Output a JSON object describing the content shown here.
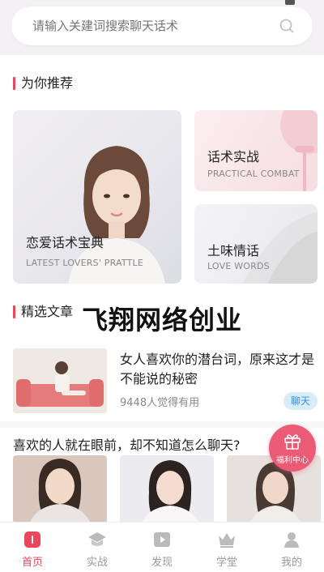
{
  "search": {
    "placeholder": "请输入关建词搜索聊天话术",
    "icon": "search-icon"
  },
  "recommend": {
    "section_title": "为你推荐",
    "cards": [
      {
        "title": "恋爱话术宝典",
        "subtitle": "LATEST LOVERS' PRATTLE"
      },
      {
        "title": "话术实战",
        "subtitle": "PRACTICAL COMBAT"
      },
      {
        "title": "土味情话",
        "subtitle": "LOVE WORDS"
      }
    ]
  },
  "watermark": {
    "text": "飞翔网络创业"
  },
  "featured": {
    "section_title": "精选文章",
    "article": {
      "title": "女人喜欢你的潜台词，原来这才是不能说的秘密",
      "meta": "9448人觉得有用",
      "tag": "聊天"
    }
  },
  "question": {
    "text": "喜欢的人就在眼前，却不知道怎么聊天?"
  },
  "floating": {
    "label": "福利中心",
    "icon": "gift-icon"
  },
  "tabbar": {
    "items": [
      {
        "label": "首页",
        "icon": "home-icon",
        "active": true
      },
      {
        "label": "实战",
        "icon": "graduation-cap-icon",
        "active": false
      },
      {
        "label": "发现",
        "icon": "play-icon",
        "active": false
      },
      {
        "label": "学堂",
        "icon": "crown-icon",
        "active": false
      },
      {
        "label": "我的",
        "icon": "user-icon",
        "active": false
      }
    ]
  },
  "colors": {
    "accent": "#e8475d",
    "tag_bg": "#d9ecfa",
    "tag_text": "#3a8fd6",
    "gift_bg": "#ec5b76"
  }
}
